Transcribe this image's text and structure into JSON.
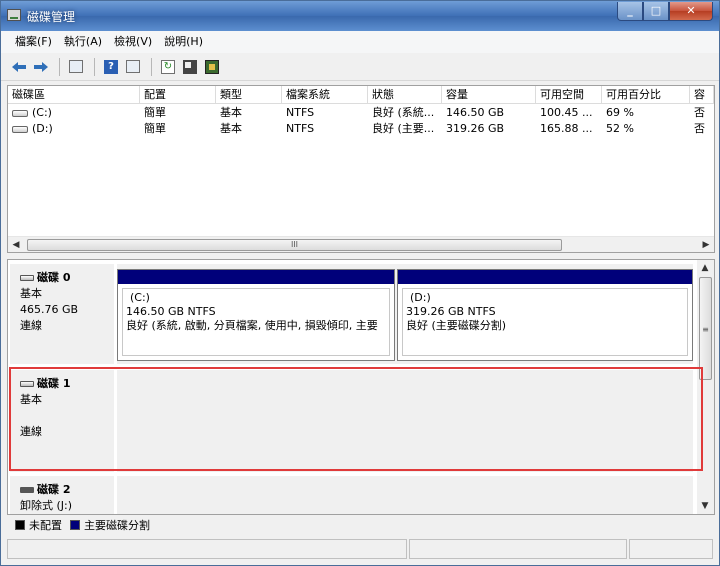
{
  "window": {
    "title": "磁碟管理"
  },
  "menu": [
    "檔案(F)",
    "執行(A)",
    "檢視(V)",
    "說明(H)"
  ],
  "toolbar": {
    "icons": [
      "back-arrow-icon",
      "forward-arrow-icon",
      "console-tree-icon",
      "help-icon",
      "show-hide-icon",
      "refresh-icon",
      "properties-icon",
      "disk-icon"
    ]
  },
  "volume_list": {
    "columns": [
      "磁碟區",
      "配置",
      "類型",
      "檔案系統",
      "狀態",
      "容量",
      "可用空間",
      "可用百分比",
      "容"
    ],
    "rows": [
      [
        "(C:)",
        "簡單",
        "基本",
        "NTFS",
        "良好 (系統...",
        "146.50 GB",
        "100.45 ...",
        "69 %",
        "否"
      ],
      [
        "(D:)",
        "簡單",
        "基本",
        "NTFS",
        "良好 (主要...",
        "319.26 GB",
        "165.88 ...",
        "52 %",
        "否"
      ]
    ],
    "scroll_thumb_glyph": "III"
  },
  "disks": [
    {
      "name": "磁碟 0",
      "type": "基本",
      "size": "465.76 GB",
      "status": "連線",
      "partitions": [
        {
          "name": "(C:)",
          "size": "146.50 GB NTFS",
          "status": "良好 (系統, 啟動, 分頁檔案, 使用中, 損毀傾印, 主要"
        },
        {
          "name": "(D:)",
          "size": "319.26 GB NTFS",
          "status": "良好 (主要磁碟分割)"
        }
      ]
    },
    {
      "name": "磁碟 1",
      "type": "基本",
      "size": "",
      "status": "連線"
    },
    {
      "name": "磁碟 2",
      "type": "卸除式 (J:)",
      "size": "",
      "status": ""
    }
  ],
  "legend": [
    {
      "label": "未配置",
      "color": "#000000"
    },
    {
      "label": "主要磁碟分割",
      "color": "#00007a"
    }
  ],
  "colors": {
    "primary_partition": "#00007a",
    "unallocated": "#000000",
    "highlight": "#e03a3a"
  }
}
